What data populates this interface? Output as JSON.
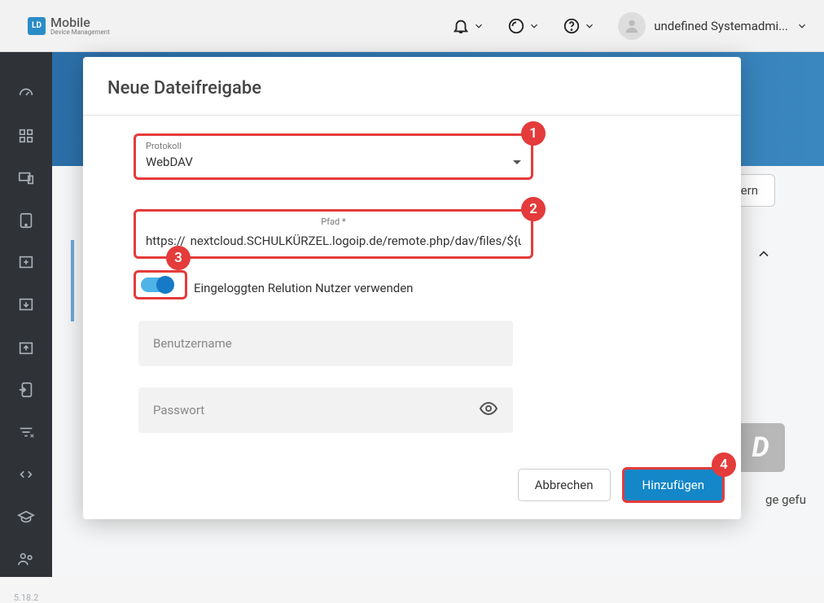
{
  "topbar": {
    "logo_badge": "LD",
    "logo_line1": "Mobile",
    "logo_line2": "Device Management",
    "user_label": "undefined Systemadmi..."
  },
  "sidebar": {
    "version": "5.18.2"
  },
  "background": {
    "save_btn": "ern",
    "letter": "D",
    "not_found": "ge gefu"
  },
  "modal": {
    "title": "Neue Dateifreigabe",
    "protocol_label": "Protokoll",
    "protocol_value": "WebDAV",
    "path_label": "Pfad *",
    "path_prefix": "https://",
    "path_value": "nextcloud.SCHULKÜRZEL.logoip.de/remote.php/dav/files/${user.nan",
    "toggle_label": "Eingeloggten Relution Nutzer verwenden",
    "username_placeholder": "Benutzername",
    "password_placeholder": "Passwort",
    "cancel": "Abbrechen",
    "add": "Hinzufügen"
  },
  "markers": {
    "m1": "1",
    "m2": "2",
    "m3": "3",
    "m4": "4"
  }
}
